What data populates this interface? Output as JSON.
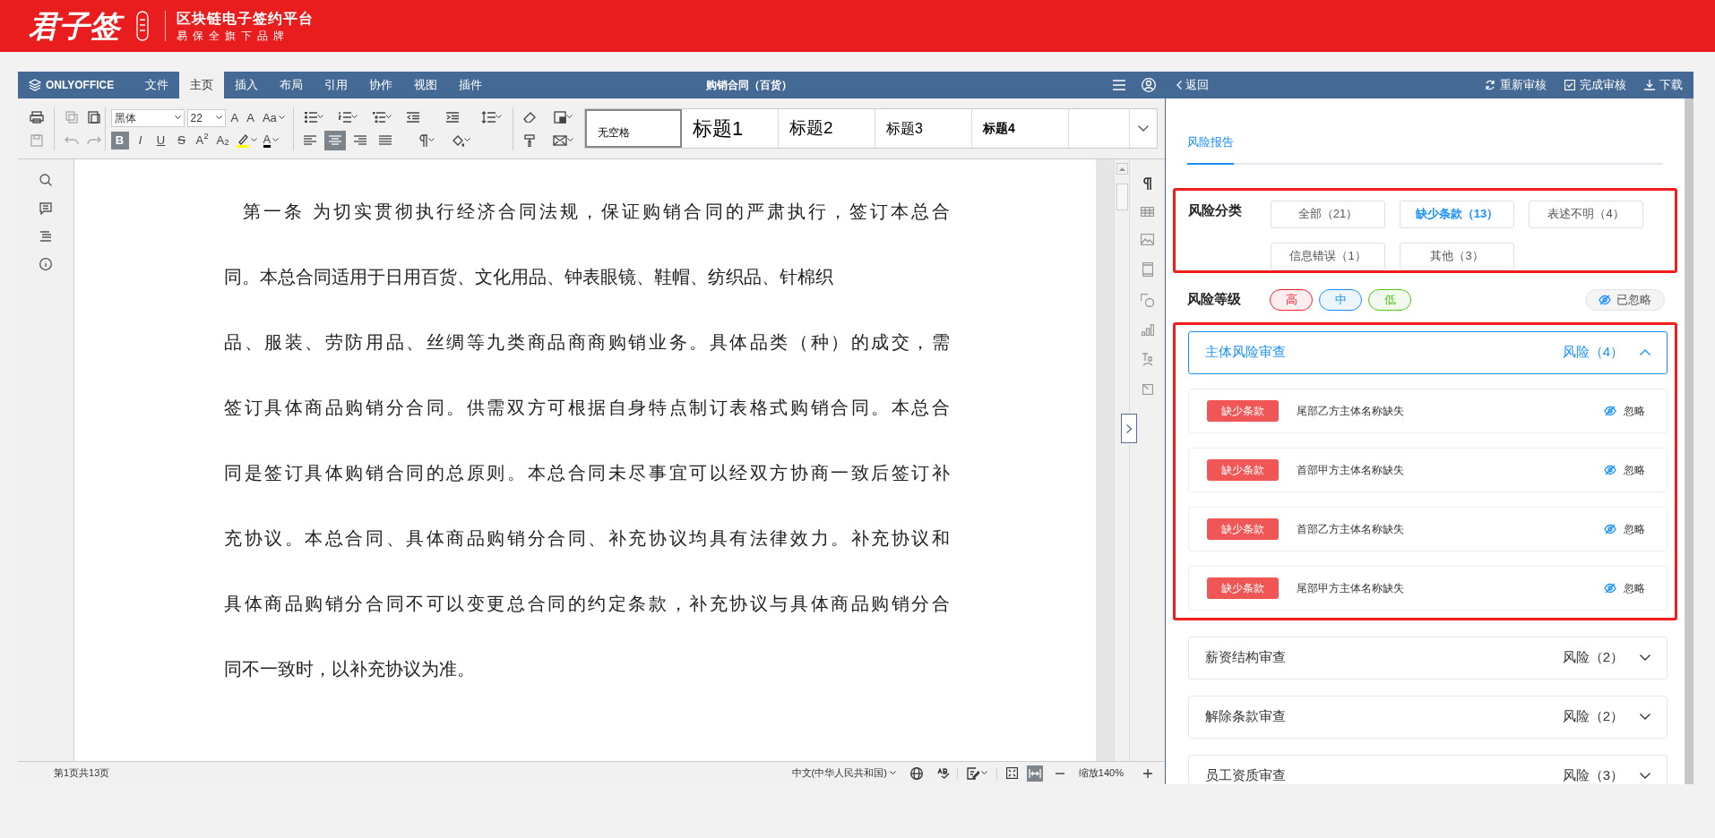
{
  "header": {
    "logo": "君子签",
    "slogan": "区块链电子签约平台",
    "subtitle": "易保全旗下品牌"
  },
  "editor": {
    "brand": "ONLYOFFICE",
    "menu": [
      {
        "label": "文件",
        "selected": false
      },
      {
        "label": "主页",
        "selected": true
      },
      {
        "label": "插入",
        "selected": false
      },
      {
        "label": "布局",
        "selected": false
      },
      {
        "label": "引用",
        "selected": false
      },
      {
        "label": "协作",
        "selected": false
      },
      {
        "label": "视图",
        "selected": false
      },
      {
        "label": "插件",
        "selected": false
      }
    ],
    "doc_title": "购销合同（百货）",
    "font_name": "黑体",
    "font_size": "22",
    "size_buttons": [
      "A",
      "A",
      "Aa"
    ],
    "format_buttons": [
      {
        "glyph": "B",
        "selected": true
      },
      {
        "glyph": "I",
        "selected": false
      },
      {
        "glyph": "U",
        "selected": false
      },
      {
        "glyph": "S",
        "selected": false
      },
      {
        "glyph": "A$^{2}$",
        "selected": false
      },
      {
        "glyph": "A$_{2}$",
        "selected": false
      }
    ],
    "font_color_glyph": "A",
    "align_buttons": [
      {
        "selected": false
      },
      {
        "selected": true
      },
      {
        "selected": false
      },
      {
        "selected": false
      }
    ],
    "styles": [
      {
        "label": "无空格",
        "selected": true
      },
      {
        "label": "标题1",
        "selected": false
      },
      {
        "label": "标题2",
        "selected": false
      },
      {
        "label": "标题3",
        "selected": false
      },
      {
        "label": "标题4",
        "selected": false
      }
    ],
    "paragraph_lines": [
      "第一条  为切实贯彻执行经济合同法规，保证购销合同的严肃执行，签订本总合",
      "同。本总合同适用于日用百货、文化用品、钟表眼镜、鞋帽、纺织品、针棉织",
      "品、服装、劳防用品、丝绸等九类商品商商购销业务。具体品类（种）的成交，需",
      "签订具体商品购销分合同。供需双方可根据自身特点制订表格式购销合同。本总合",
      "同是签订具体购销合同的总原则。本总合同未尽事宜可以经双方协商一致后签订补",
      "充协议。本总合同、具体商品购销分合同、补充协议均具有法律效力。补充协议和",
      "具体商品购销分合同不可以变更总合同的约定条款，补充协议与具体商品购销分合",
      "同不一致时，以补充协议为准。"
    ],
    "status": {
      "page": "第1页共13页",
      "language": "中文(中华人民共和国)",
      "zoom": "缩放140%"
    }
  },
  "panel": {
    "back": "返回",
    "actions": [
      {
        "kind": "refresh",
        "label": "重新审核"
      },
      {
        "kind": "check",
        "label": "完成审核"
      },
      {
        "kind": "download",
        "label": "下载"
      }
    ],
    "tab": "风险报告",
    "category_label": "风险分类",
    "categories": [
      {
        "label": "全部（21）",
        "selected": false
      },
      {
        "label": "缺少条款（13）",
        "selected": true
      },
      {
        "label": "表述不明（4）",
        "selected": false
      },
      {
        "label": "信息错误（1）",
        "selected": false
      },
      {
        "label": "其他（3）",
        "selected": false
      }
    ],
    "level_label": "风险等级",
    "levels": [
      {
        "label": "高",
        "color": "#f5222d"
      },
      {
        "label": "中",
        "color": "#1890ff"
      },
      {
        "label": "低",
        "color": "#52c41a"
      }
    ],
    "ignored": "已忽略",
    "sections": [
      {
        "title": "主体风险审查",
        "risk": "风险（4）",
        "expanded": true,
        "items": [
          {
            "tag": "缺少条款",
            "text": "尾部乙方主体名称缺失",
            "action": "忽略"
          },
          {
            "tag": "缺少条款",
            "text": "首部甲方主体名称缺失",
            "action": "忽略"
          },
          {
            "tag": "缺少条款",
            "text": "首部乙方主体名称缺失",
            "action": "忽略"
          },
          {
            "tag": "缺少条款",
            "text": "尾部甲方主体名称缺失",
            "action": "忽略"
          }
        ]
      },
      {
        "title": "薪资结构审查",
        "risk": "风险（2）",
        "expanded": false
      },
      {
        "title": "解除条款审查",
        "risk": "风险（2）",
        "expanded": false
      },
      {
        "title": "员工资质审查",
        "risk": "风险（3）",
        "expanded": false
      }
    ]
  }
}
